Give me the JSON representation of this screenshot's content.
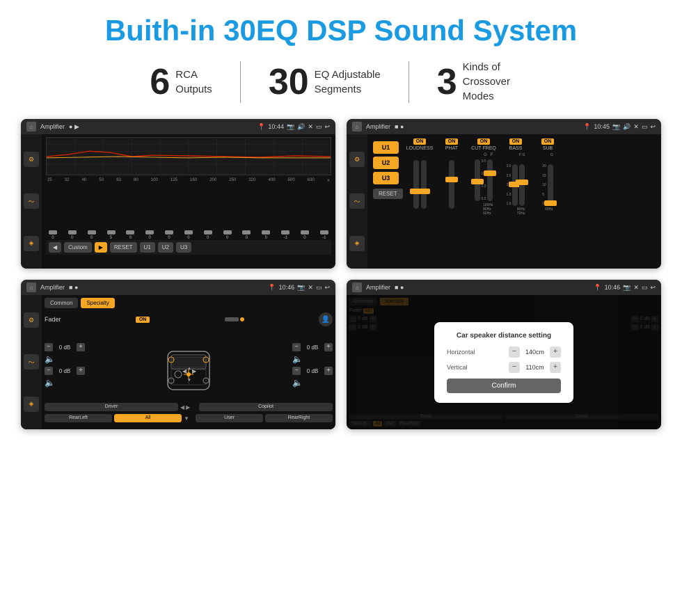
{
  "page": {
    "title": "Buith-in 30EQ DSP Sound System",
    "stats": [
      {
        "number": "6",
        "label": "RCA\nOutputs"
      },
      {
        "number": "30",
        "label": "EQ Adjustable\nSegments"
      },
      {
        "number": "3",
        "label": "Kinds of\nCrossover Modes"
      }
    ],
    "screens": [
      {
        "id": "screen1",
        "app_title": "Amplifier",
        "time": "10:44",
        "type": "eq_sliders",
        "freq_labels": [
          "25",
          "32",
          "40",
          "50",
          "63",
          "80",
          "100",
          "125",
          "160",
          "200",
          "250",
          "320",
          "400",
          "500",
          "630"
        ],
        "slider_values": [
          "0",
          "0",
          "0",
          "5",
          "0",
          "0",
          "0",
          "0",
          "0",
          "0",
          "0",
          "0",
          "-1",
          "0",
          "-1"
        ],
        "buttons": [
          "Custom",
          "RESET",
          "U1",
          "U2",
          "U3"
        ]
      },
      {
        "id": "screen2",
        "app_title": "Amplifier",
        "time": "10:45",
        "type": "amp_controls",
        "u_buttons": [
          "U1",
          "U2",
          "U3"
        ],
        "controls": [
          {
            "on": true,
            "label": "LOUDNESS"
          },
          {
            "on": true,
            "label": "PHAT"
          },
          {
            "on": true,
            "label": "CUT FREQ"
          },
          {
            "on": true,
            "label": "BASS"
          },
          {
            "on": true,
            "label": "SUB"
          }
        ],
        "reset_label": "RESET"
      },
      {
        "id": "screen3",
        "app_title": "Amplifier",
        "time": "10:46",
        "type": "fader",
        "tabs": [
          "Common",
          "Specialty"
        ],
        "active_tab": "Specialty",
        "fader_label": "Fader",
        "fader_on": true,
        "vol_values": [
          "0 dB",
          "0 dB",
          "0 dB",
          "0 dB"
        ],
        "footer_buttons": [
          "Driver",
          "",
          "",
          "User",
          "RearRight"
        ],
        "footer_all": "All",
        "footer_rear_left": "RearLeft",
        "footer_copilot": "Copilot"
      },
      {
        "id": "screen4",
        "app_title": "Amplifier",
        "time": "10:46",
        "type": "dialog",
        "dialog_title": "Car speaker distance setting",
        "horizontal_label": "Horizontal",
        "horizontal_value": "140cm",
        "vertical_label": "Vertical",
        "vertical_value": "110cm",
        "confirm_label": "Confirm",
        "footer_buttons": [
          "Driver",
          "",
          "User",
          "RearRight"
        ],
        "footer_rear_left": "RearLef...",
        "footer_copilot": "Copilot",
        "vol_values": [
          "0 dB",
          "0 dB"
        ]
      }
    ]
  }
}
